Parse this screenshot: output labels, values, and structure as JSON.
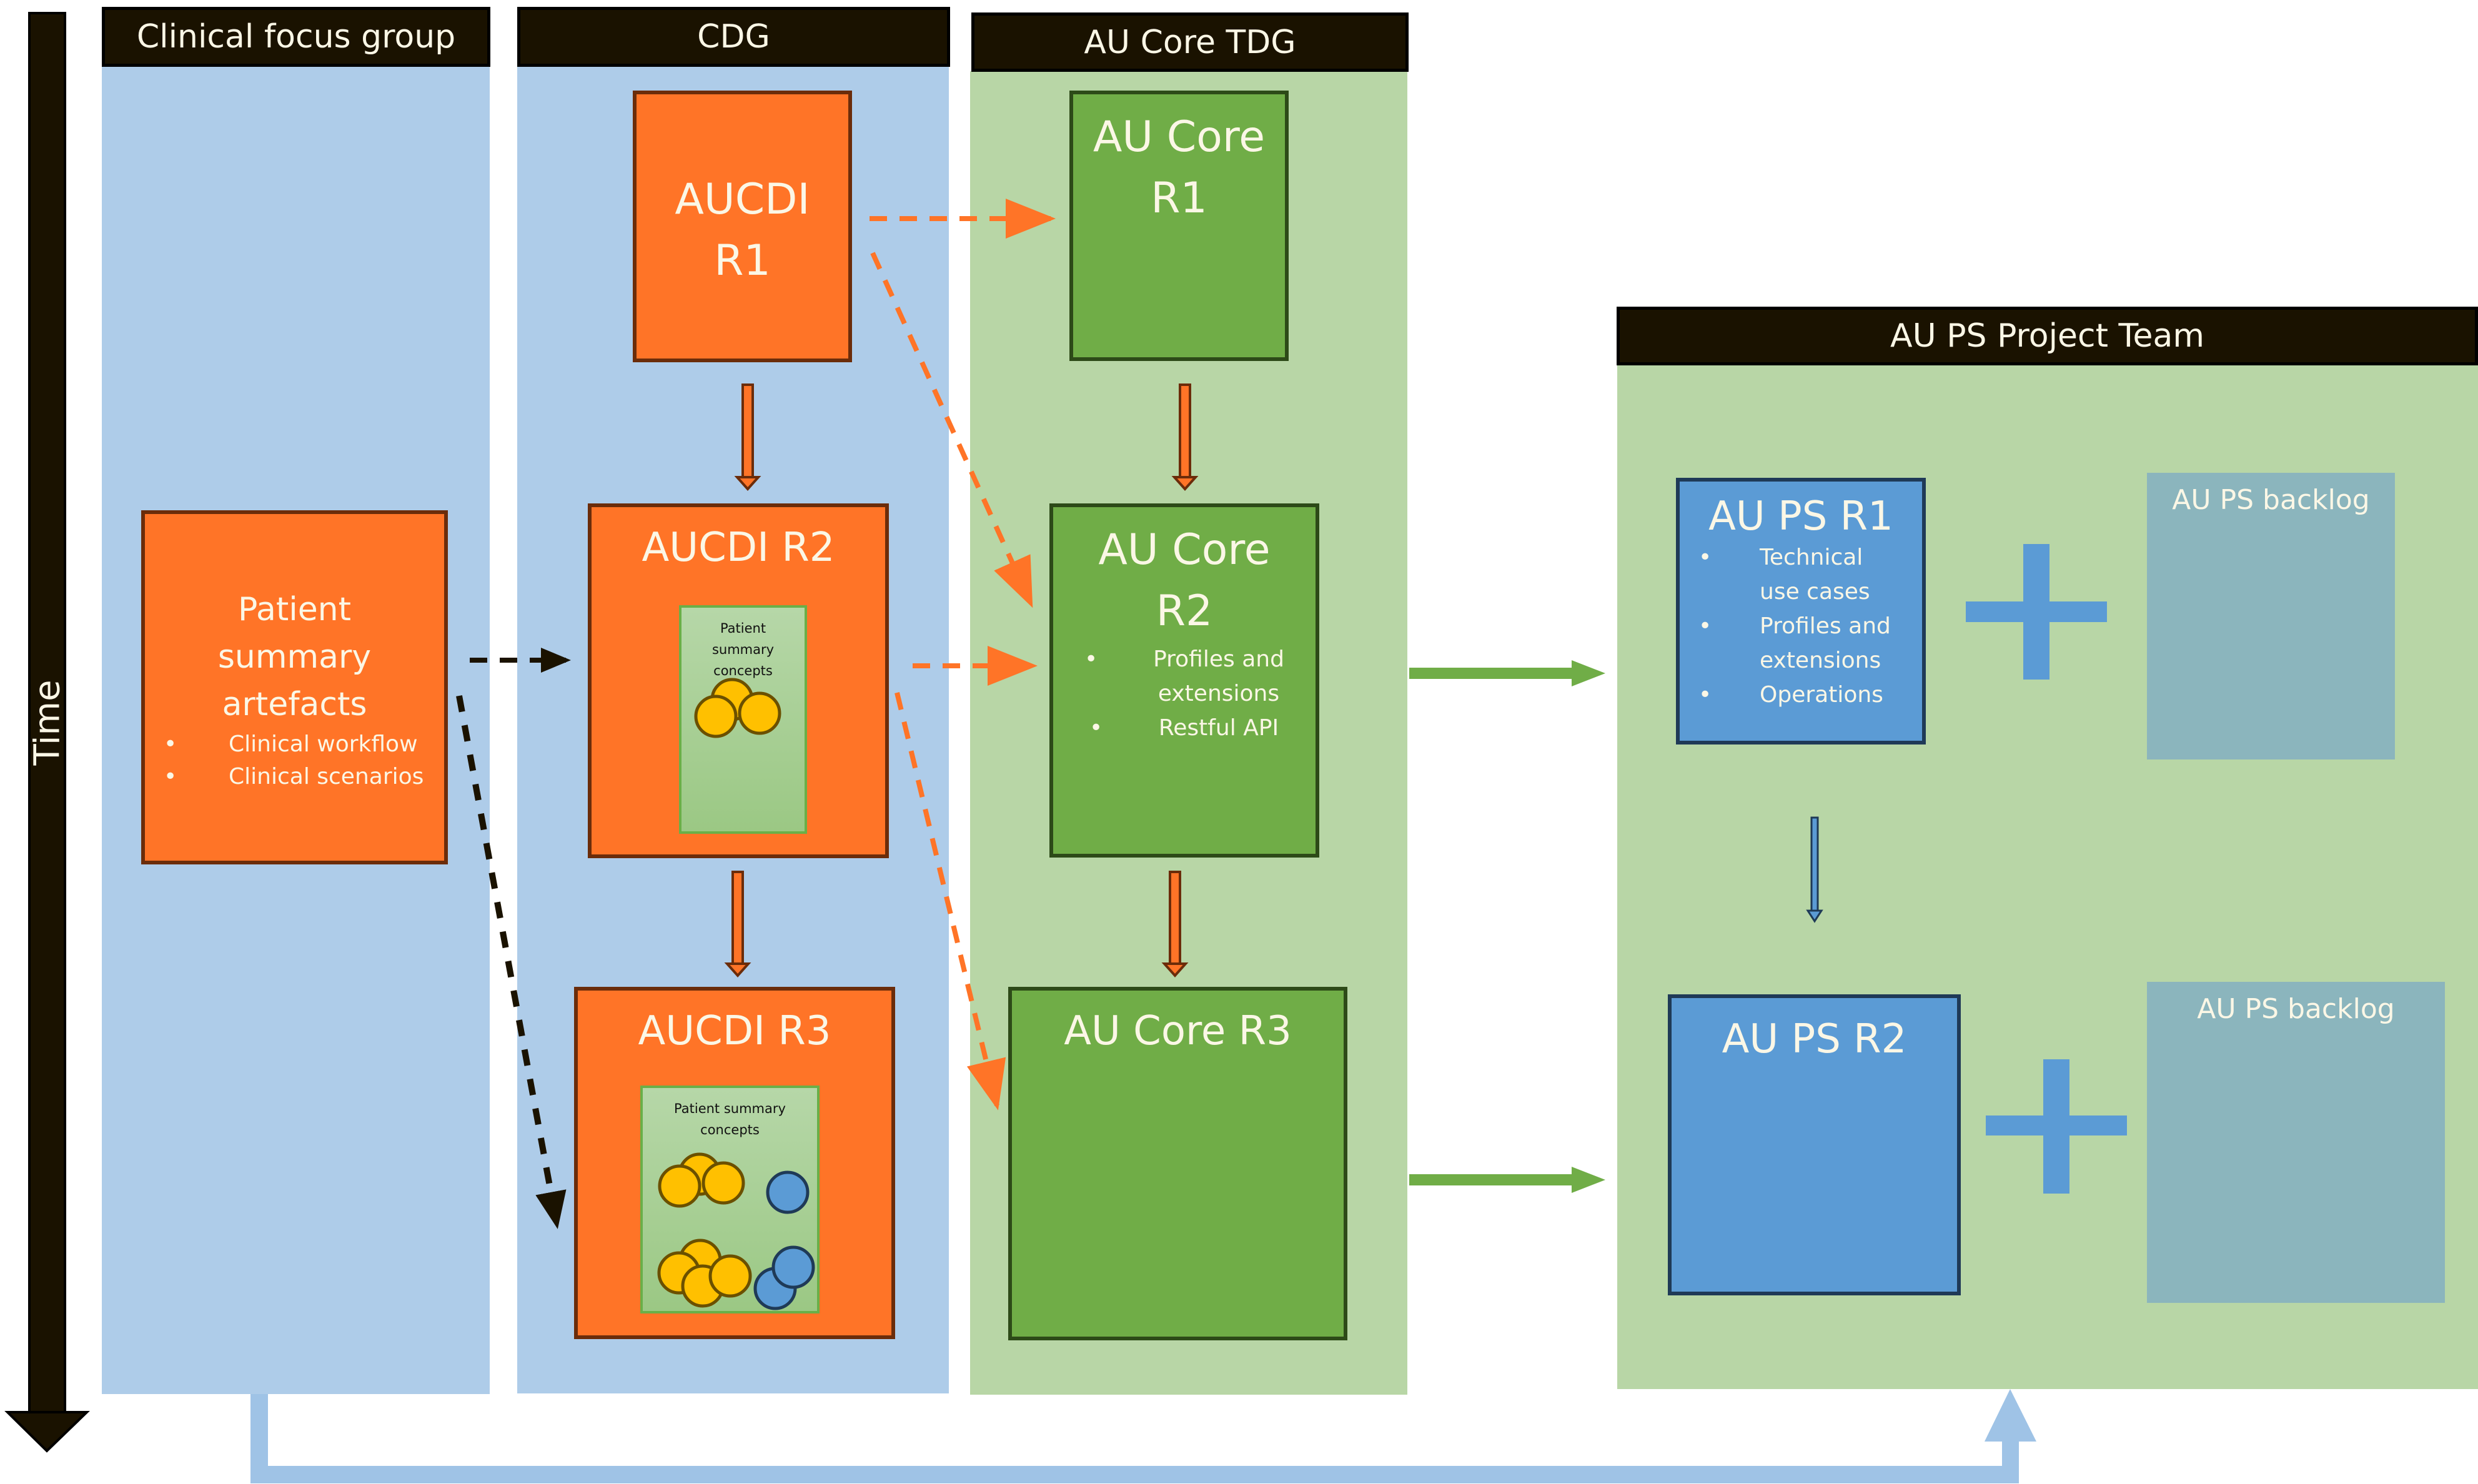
{
  "timeline": {
    "label": "Time"
  },
  "lanes": [
    {
      "id": "clinical",
      "header": "Clinical focus group",
      "color": "#aecce9"
    },
    {
      "id": "cdg",
      "header": "CDG",
      "color": "#aecce9"
    },
    {
      "id": "tdg",
      "header": "AU Core TDG",
      "color": "#b8d6a6"
    },
    {
      "id": "psteam",
      "header": "AU PS Project Team",
      "color": "#b8d6a6"
    }
  ],
  "clinical": {
    "artefacts": {
      "title_lines": [
        "Patient",
        "summary",
        "artefacts"
      ],
      "bullets": [
        "Clinical workflow",
        "Clinical scenarios"
      ]
    }
  },
  "cdg": {
    "r1": {
      "title_lines": [
        "AUCDI",
        "R1"
      ]
    },
    "r2": {
      "title": "AUCDI R2",
      "concepts_lines": [
        "Patient",
        "summary",
        "concepts"
      ]
    },
    "r3": {
      "title": "AUCDI R3",
      "concepts_lines": [
        "Patient summary",
        "concepts"
      ]
    }
  },
  "tdg": {
    "r1": {
      "title_lines": [
        "AU Core",
        "R1"
      ]
    },
    "r2": {
      "title_lines": [
        "AU Core",
        "R2"
      ],
      "bullets": [
        "Profiles and extensions",
        "Restful API"
      ]
    },
    "r3": {
      "title": "AU Core R3"
    }
  },
  "psteam": {
    "r1": {
      "title": "AU PS R1",
      "bullets": [
        "Technical use cases",
        "Profiles and extensions",
        "Operations"
      ]
    },
    "r2": {
      "title": "AU PS R2"
    },
    "backlog1": {
      "title": "AU PS backlog"
    },
    "backlog2": {
      "title": "AU PS backlog"
    },
    "plus_symbol": "+"
  },
  "colors": {
    "header_bg": "#1a1200",
    "clinical_lane": "#aecce9",
    "core_lane": "#b8d6a6",
    "aucdi_orange": "#ff7427",
    "aucore_green": "#70ad47",
    "aups_blue": "#5b9bd5",
    "backlog_teal": "#8bb5bd",
    "concept_yellow": "#ffc000",
    "concept_blue": "#5b9bd5"
  }
}
